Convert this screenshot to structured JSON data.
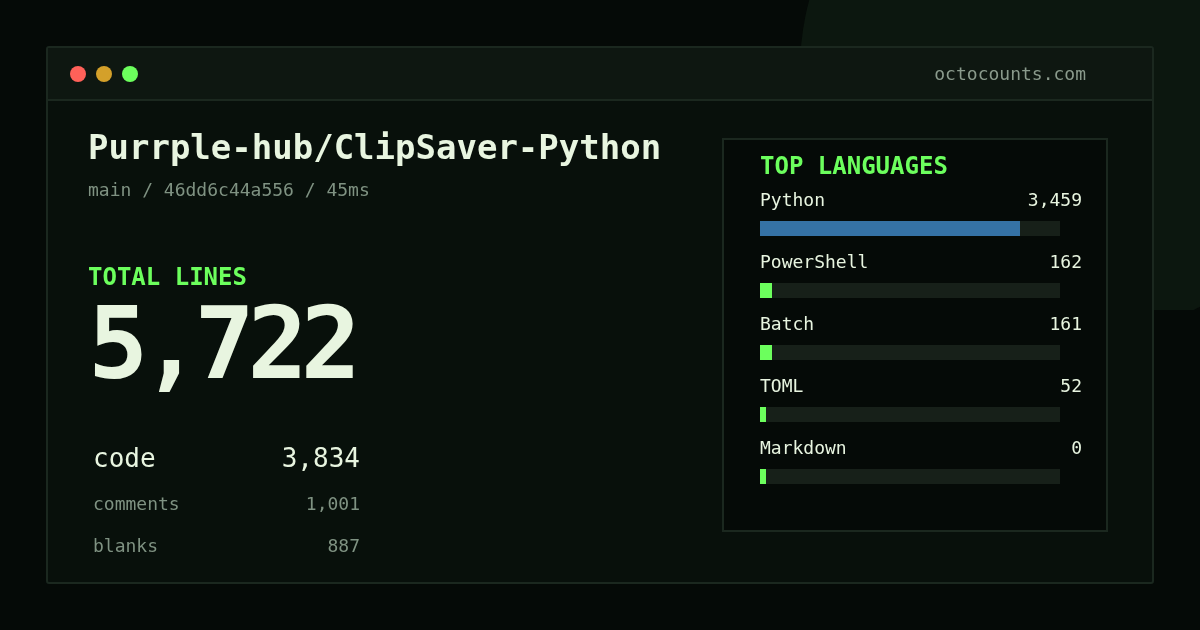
{
  "window": {
    "controls": [
      {
        "color": "#ff6159"
      },
      {
        "color": "#d4a02a"
      },
      {
        "color": "#6cff5d"
      }
    ],
    "url": "octocounts.com"
  },
  "repo": {
    "title": "Purrple-hub/ClipSaver-Python",
    "meta": "main / 46dd6c44a556 / 45ms"
  },
  "total": {
    "label": "TOTAL LINES",
    "value": "5,722"
  },
  "breakdown": [
    {
      "kind": "primary",
      "label": "code",
      "value": "3,834"
    },
    {
      "kind": "secondary",
      "label": "comments",
      "value": "1,001"
    },
    {
      "kind": "secondary",
      "label": "blanks",
      "value": "887"
    }
  ],
  "languages": {
    "title": "TOP LANGUAGES",
    "items": [
      {
        "name": "Python",
        "count": "3,459",
        "level": 0.867,
        "color": "#3572a5"
      },
      {
        "name": "PowerShell",
        "count": "162",
        "level": 0.04,
        "color": "#6cff5d"
      },
      {
        "name": "Batch",
        "count": "161",
        "level": 0.04,
        "color": "#6cff5d"
      },
      {
        "name": "TOML",
        "count": "52",
        "level": 0.02,
        "color": "#6cff5d"
      },
      {
        "name": "Markdown",
        "count": "0",
        "level": 0.02,
        "color": "#6cff5d"
      }
    ]
  }
}
